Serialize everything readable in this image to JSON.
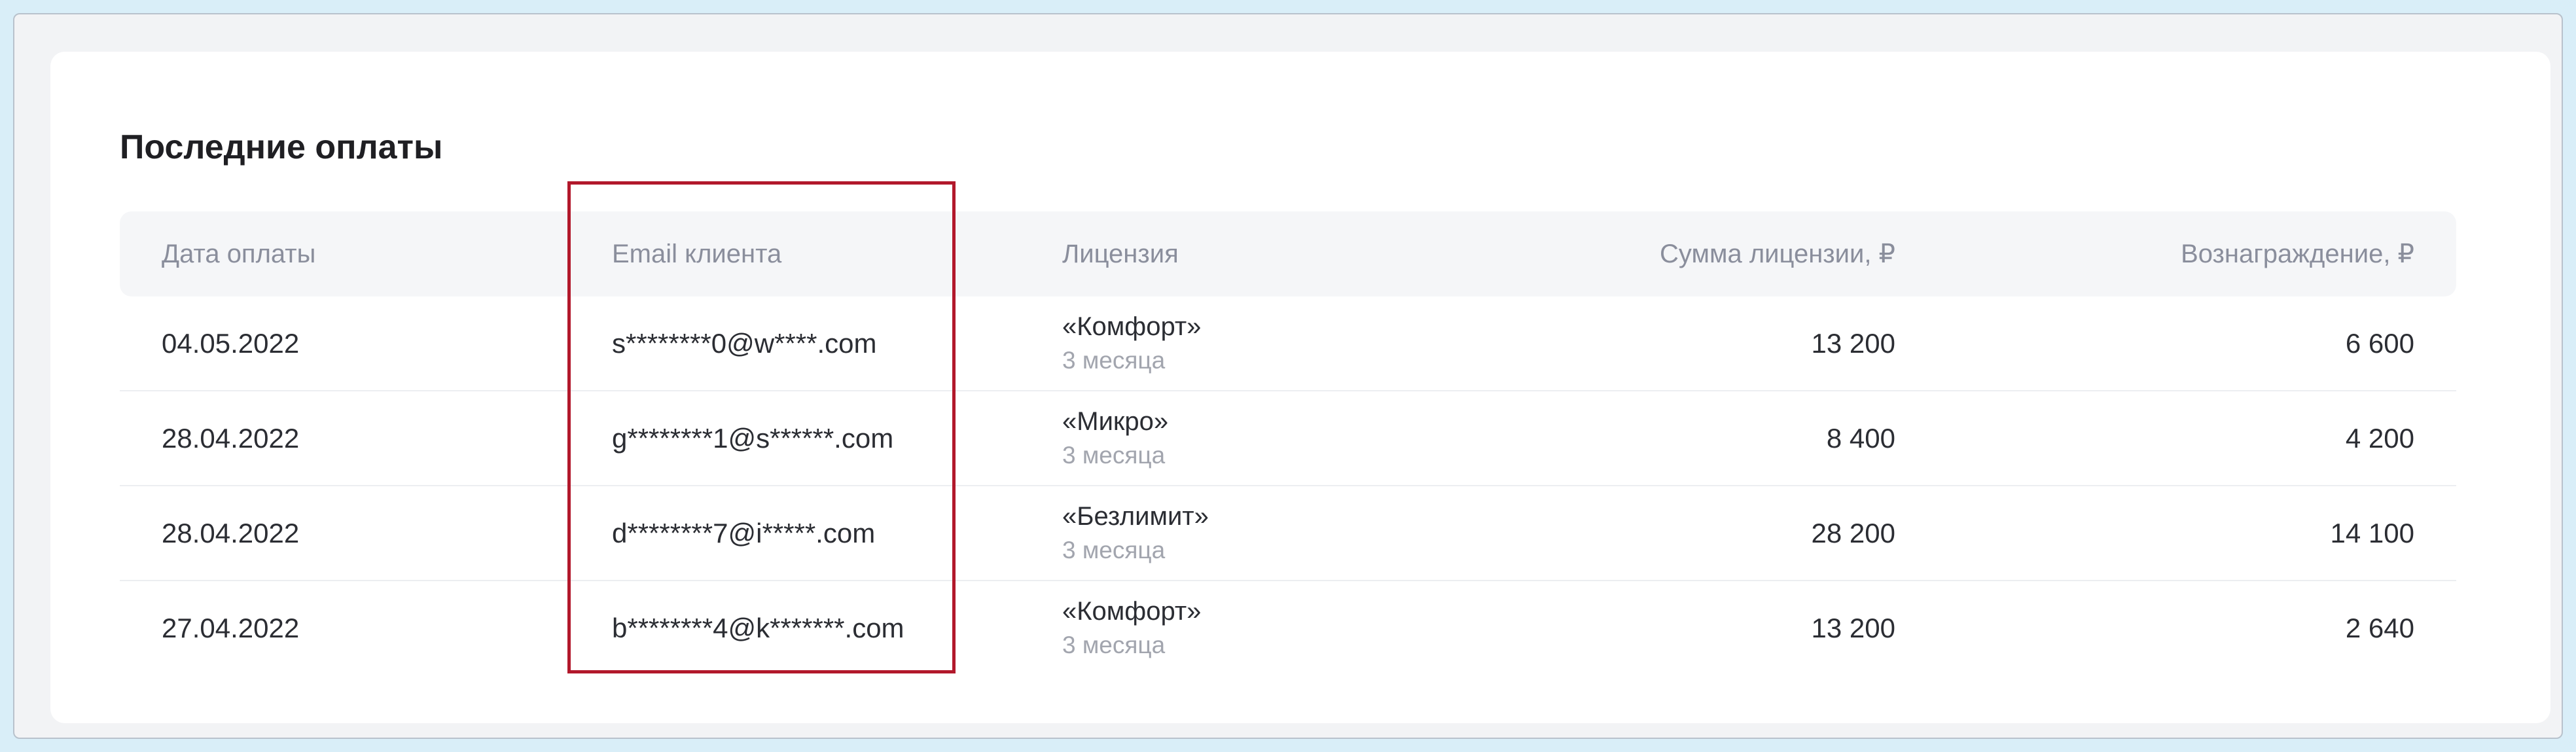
{
  "page": {
    "title": "Последние оплаты"
  },
  "table": {
    "headers": {
      "date": "Дата оплаты",
      "email": "Email клиента",
      "license": "Лицензия",
      "sum": "Сумма лицензии, ₽",
      "reward": "Вознаграждение, ₽"
    },
    "rows": [
      {
        "date": "04.05.2022",
        "email": "s********0@w****.com",
        "license": "«Комфорт»",
        "period": "3 месяца",
        "sum": "13 200",
        "reward": "6 600"
      },
      {
        "date": "28.04.2022",
        "email": "g********1@s******.com",
        "license": "«Микро»",
        "period": "3 месяца",
        "sum": "8 400",
        "reward": "4 200"
      },
      {
        "date": "28.04.2022",
        "email": "d********7@i*****.com",
        "license": "«Безлимит»",
        "period": "3 месяца",
        "sum": "28 200",
        "reward": "14 100"
      },
      {
        "date": "27.04.2022",
        "email": "b********4@k*******.com",
        "license": "«Комфорт»",
        "period": "3 месяца",
        "sum": "13 200",
        "reward": "2 640"
      }
    ]
  },
  "colors": {
    "highlight": "#b2182b",
    "background": "#d9eef8"
  }
}
